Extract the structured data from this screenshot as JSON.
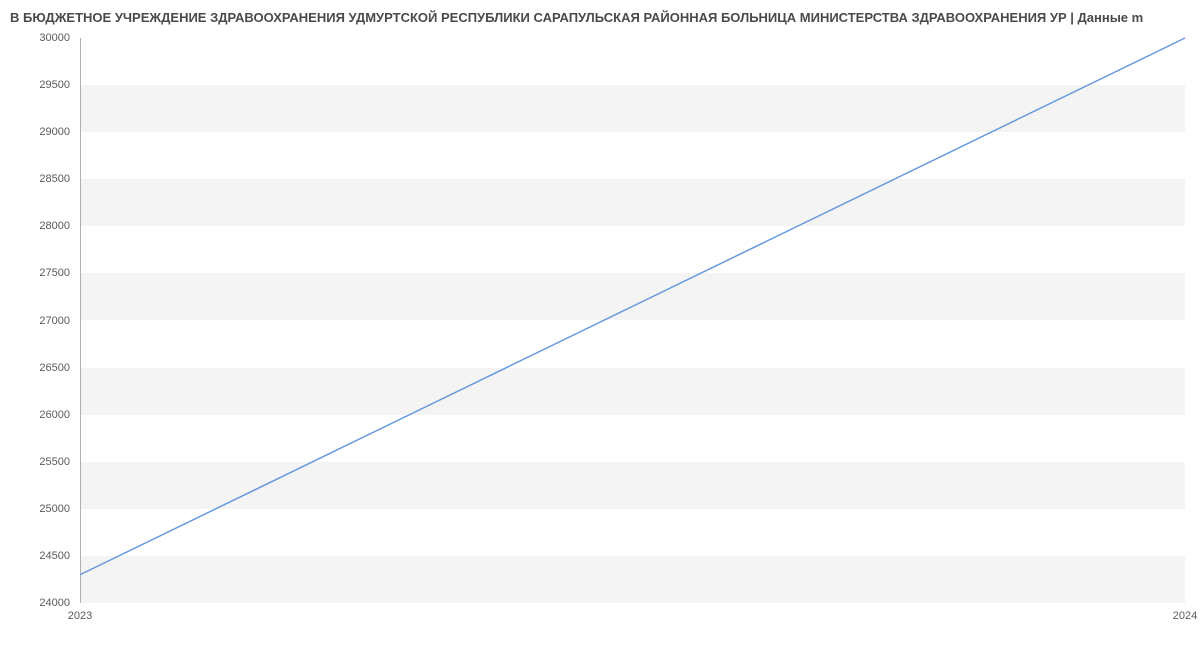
{
  "chart_data": {
    "type": "line",
    "title": "В БЮДЖЕТНОЕ УЧРЕЖДЕНИЕ ЗДРАВООХРАНЕНИЯ УДМУРТСКОЙ РЕСПУБЛИКИ САРАПУЛЬСКАЯ РАЙОННАЯ БОЛЬНИЦА МИНИСТЕРСТВА ЗДРАВООХРАНЕНИЯ УР | Данные m",
    "x": [
      "2023",
      "2024"
    ],
    "values": [
      24300,
      30000
    ],
    "xlabel": "",
    "ylabel": "",
    "ylim": [
      24000,
      30000
    ],
    "y_ticks": [
      24000,
      24500,
      25000,
      25500,
      26000,
      26500,
      27000,
      27500,
      28000,
      28500,
      29000,
      29500,
      30000
    ],
    "line_color": "#6699dd",
    "grid": true
  }
}
